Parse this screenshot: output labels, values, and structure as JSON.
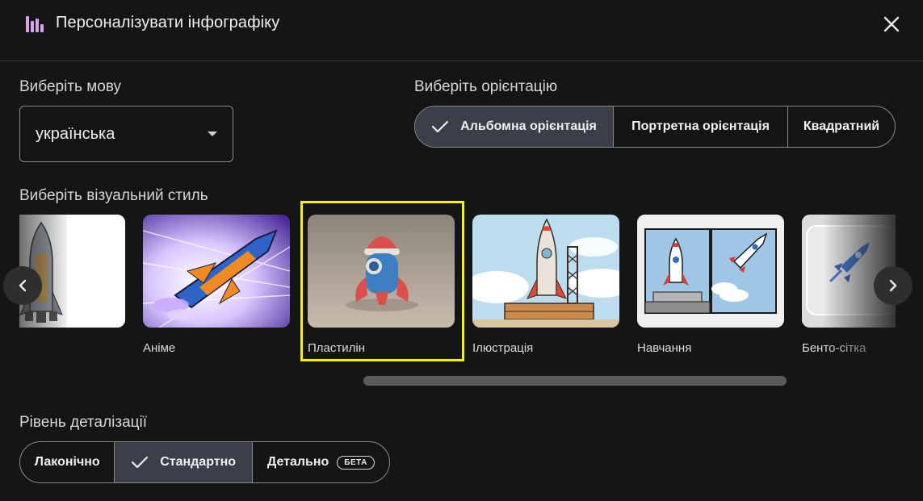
{
  "header": {
    "title": "Персоналізувати інфографіку",
    "icon": "infographic-icon",
    "close_icon": "close-icon"
  },
  "language": {
    "label": "Виберіть мову",
    "value": "українська"
  },
  "orientation": {
    "label": "Виберіть орієнтацію",
    "options": [
      {
        "label": "Альбомна орієнтація",
        "selected": true
      },
      {
        "label": "Портретна орієнтація",
        "selected": false
      },
      {
        "label": "Квадратний",
        "selected": false
      }
    ]
  },
  "style": {
    "label": "Виберіть візуальний стиль",
    "cards": [
      {
        "label": ""
      },
      {
        "label": "Аніме"
      },
      {
        "label": "Пластилін",
        "selected": true
      },
      {
        "label": "Ілюстрація"
      },
      {
        "label": "Навчання"
      },
      {
        "label": "Бенто-сітка"
      }
    ]
  },
  "detail": {
    "label": "Рівень деталізації",
    "options": [
      {
        "label": "Лаконічно",
        "selected": false
      },
      {
        "label": "Стандартно",
        "selected": true
      },
      {
        "label": "Детально",
        "selected": false,
        "badge": "БЕТА"
      }
    ]
  },
  "colors": {
    "background": "#151515",
    "selected_segment": "#3a3f4a",
    "selection_highlight": "#f2f20a"
  }
}
